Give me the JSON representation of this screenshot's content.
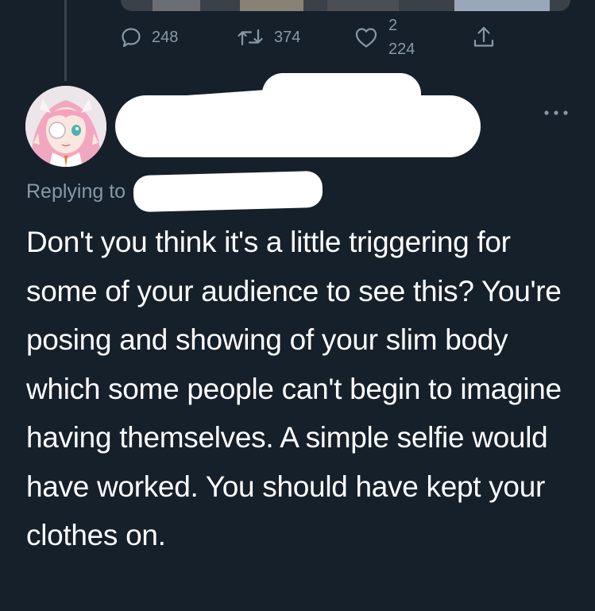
{
  "parent_tweet": {
    "actions": {
      "reply": {
        "icon": "reply-icon",
        "count": "248"
      },
      "retweet": {
        "icon": "retweet-icon",
        "count": "374"
      },
      "like": {
        "icon": "heart-icon",
        "count": "2 224"
      },
      "share": {
        "icon": "share-icon"
      }
    }
  },
  "reply_tweet": {
    "avatar": {
      "icon": "avatar-anime-character"
    },
    "more_icon": "more-dots-icon",
    "replying_to_label": "Replying to",
    "text": "Don't you think it's a little triggering for some of your audience to see this? You're posing and showing of your slim body which some people can't begin to imagine having themselves. A simple selfie would have worked. You should have kept your clothes on."
  },
  "colors": {
    "background": "#15202b",
    "text_primary": "#ffffff",
    "text_secondary": "#8899a6",
    "thread_line": "#38444d"
  }
}
